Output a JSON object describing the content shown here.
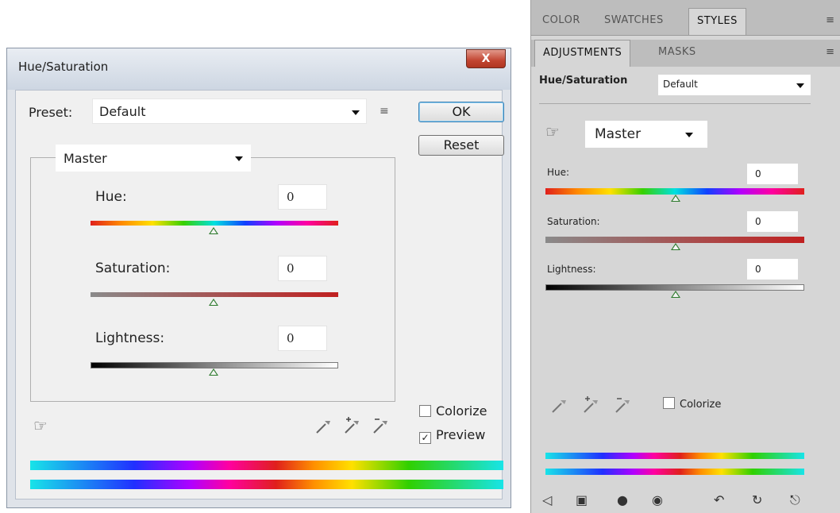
{
  "dialog": {
    "title": "Hue/Saturation",
    "close_label": "X",
    "preset_label": "Preset:",
    "preset_value": "Default",
    "ok_label": "OK",
    "reset_label": "Reset",
    "channel_value": "Master",
    "hue_label": "Hue:",
    "hue_value": "0",
    "saturation_label": "Saturation:",
    "saturation_value": "0",
    "lightness_label": "Lightness:",
    "lightness_value": "0",
    "colorize_label": "Colorize",
    "colorize_checked": false,
    "preview_label": "Preview",
    "preview_checked": true
  },
  "panel": {
    "tabs_row1": [
      "COLOR",
      "SWATCHES",
      "STYLES"
    ],
    "tabs_row1_active": "STYLES",
    "tabs_row2": [
      "ADJUSTMENTS",
      "MASKS"
    ],
    "tabs_row2_active": "ADJUSTMENTS",
    "title": "Hue/Saturation",
    "preset_value": "Default",
    "channel_value": "Master",
    "hue_label": "Hue:",
    "hue_value": "0",
    "saturation_label": "Saturation:",
    "saturation_value": "0",
    "lightness_label": "Lightness:",
    "lightness_value": "0",
    "colorize_label": "Colorize",
    "colorize_checked": false,
    "footer_icons": [
      "back-arrow-icon",
      "clip-icon",
      "visibility-dot-icon",
      "eye-icon",
      "previous-state-icon",
      "reset-icon",
      "trash-icon"
    ]
  }
}
